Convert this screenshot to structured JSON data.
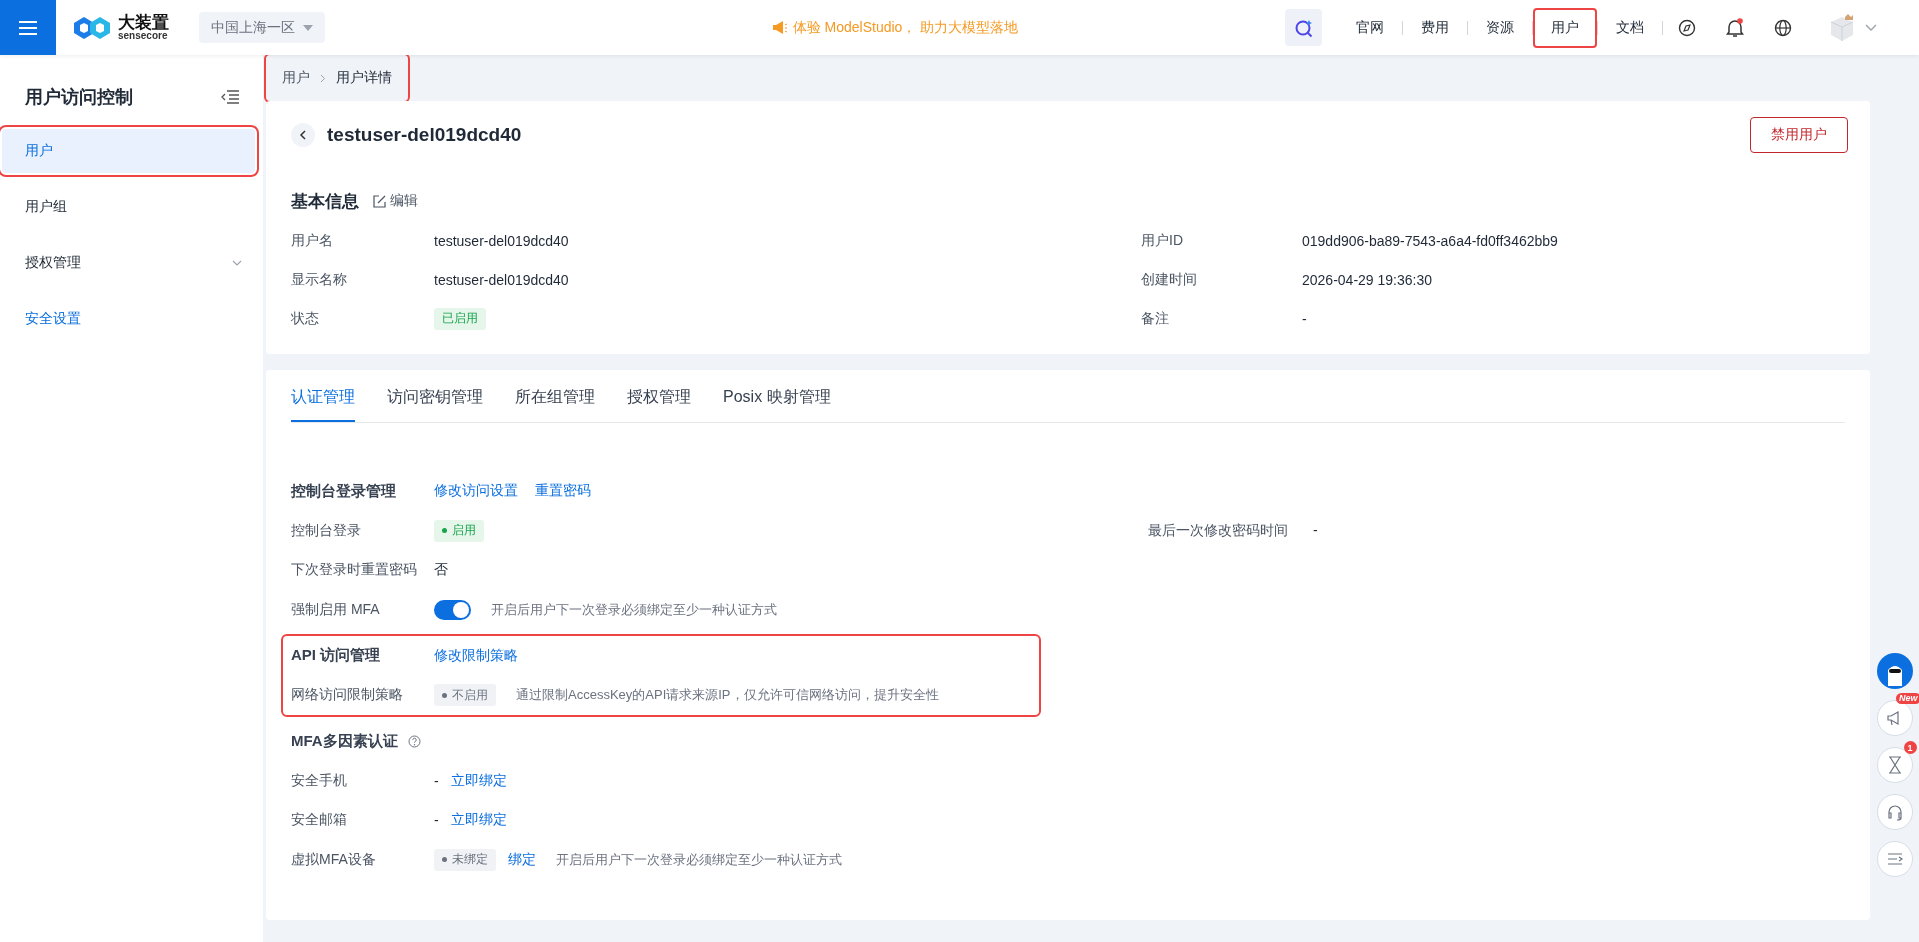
{
  "topbar": {
    "brand": "大装置",
    "brand_sub": "sensecore",
    "region": "中国上海一区",
    "promo": "体验 ModelStudio， 助力大模型落地",
    "nav_links": [
      {
        "label": "官网",
        "highlighted": false
      },
      {
        "label": "费用",
        "highlighted": false
      },
      {
        "label": "资源",
        "highlighted": false
      },
      {
        "label": "用户",
        "highlighted": true
      },
      {
        "label": "文档",
        "highlighted": false
      }
    ]
  },
  "sidebar": {
    "title": "用户访问控制",
    "items": [
      {
        "label": "用户",
        "selected": true,
        "kind": "item",
        "highlighted": true
      },
      {
        "label": "用户组",
        "selected": false,
        "kind": "item",
        "highlighted": false
      },
      {
        "label": "授权管理",
        "selected": false,
        "kind": "group",
        "highlighted": false
      },
      {
        "label": "安全设置",
        "selected": false,
        "kind": "link",
        "highlighted": false
      }
    ]
  },
  "breadcrumb": {
    "items": [
      "用户",
      "用户详情"
    ],
    "highlighted": true
  },
  "header": {
    "title": "testuser-del019dcd40",
    "action": "禁用用户"
  },
  "basic_info": {
    "title": "基本信息",
    "edit": "编辑",
    "fields": [
      {
        "label": "用户名",
        "value": "testuser-del019dcd40"
      },
      {
        "label": "用户ID",
        "value": "019dd906-ba89-7543-a6a4-fd0ff3462bb9"
      },
      {
        "label": "显示名称",
        "value": "testuser-del019dcd40"
      },
      {
        "label": "创建时间",
        "value": "2026-04-29 19:36:30"
      },
      {
        "label": "状态",
        "tag": {
          "text": "已启用",
          "enabled": true,
          "dot": false
        }
      },
      {
        "label": "备注",
        "value": "-"
      }
    ]
  },
  "tabs": [
    {
      "label": "认证管理",
      "selected": true
    },
    {
      "label": "访问密钥管理",
      "selected": false
    },
    {
      "label": "所在组管理",
      "selected": false
    },
    {
      "label": "授权管理",
      "selected": false
    },
    {
      "label": "Posix 映射管理",
      "selected": false
    }
  ],
  "sections": [
    {
      "title": "控制台登录管理",
      "help": false,
      "highlighted": false,
      "actions": [
        "修改访问设置",
        "重置密码"
      ],
      "rows": [
        {
          "label": "控制台登录",
          "tag": {
            "text": "启用",
            "enabled": true,
            "dot": true
          },
          "aside_label": "最后一次修改密码时间",
          "aside_value": "-"
        },
        {
          "label": "下次登录时重置密码",
          "value": "否"
        },
        {
          "label": "强制启用 MFA",
          "toggle": {
            "on": true
          },
          "hint": "开启后用户下一次登录必须绑定至少一种认证方式"
        }
      ]
    },
    {
      "title": "API 访问管理",
      "help": false,
      "highlighted": true,
      "actions": [
        "修改限制策略"
      ],
      "rows": [
        {
          "label": "网络访问限制策略",
          "tag": {
            "text": "不启用",
            "enabled": false,
            "dot": true
          },
          "hint": "通过限制AccessKey的API请求来源IP，仅允许可信网络访问，提升安全性"
        }
      ]
    },
    {
      "title": "MFA多因素认证",
      "help": true,
      "highlighted": false,
      "rows": [
        {
          "label": "安全手机",
          "value": "-",
          "link": "立即绑定"
        },
        {
          "label": "安全邮箱",
          "value": "-",
          "link": "立即绑定"
        },
        {
          "label": "虚拟MFA设备",
          "tag": {
            "text": "未绑定",
            "enabled": false,
            "dot": true
          },
          "link": "绑定",
          "hint": "开启后用户下一次登录必须绑定至少一种认证方式"
        }
      ]
    }
  ],
  "float_bar": {
    "new_badge": "New",
    "count_badge": "1"
  }
}
